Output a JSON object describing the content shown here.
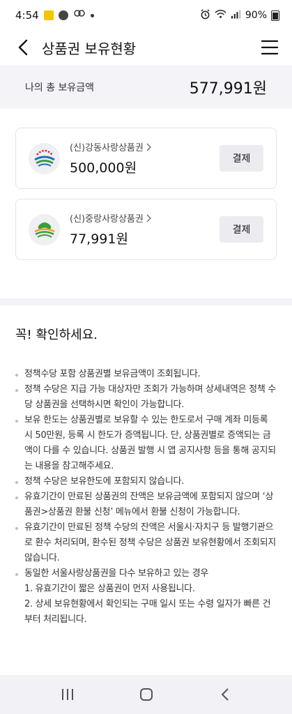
{
  "status_bar": {
    "time": "4:54",
    "battery": "90%"
  },
  "header": {
    "title": "상품권 보유현황"
  },
  "summary": {
    "label": "나의 총 보유금액",
    "amount": "577,991원"
  },
  "vouchers": [
    {
      "name": "(신)강동사랑상품권",
      "amount": "500,000원",
      "pay_label": "결제"
    },
    {
      "name": "(신)중랑사랑상품권",
      "amount": "77,991원",
      "pay_label": "결제"
    }
  ],
  "notice": {
    "title": "꼭! 확인하세요.",
    "items": [
      "정책수당 포함 상품권별 보유금액이 조회됩니다.",
      "정책 수당은 지급 가능 대상자만 조회가 가능하며 상세내역은 정책 수당 상품권을 선택하시면 확인이 가능합니다.",
      "보유 한도는 상품권별로 보유할 수 있는 한도로서 구매 계좌 미등록 시 50만원, 등록 시 한도가 증액됩니다. 단, 상품권별로 증액되는 금액이 다를 수 있습니다. 상품권 발행 시 앱 공지사항 등을 통해 공지되는 내용을 참고해주세요.",
      "정책 수당은 보유한도에 포함되지 않습니다.",
      "유효기간이 만료된 상품권의 잔액은 보유금액에 포함되지 않으며 ‘상품권>상품권 환불 신청’ 메뉴에서 환불 신청이 가능합니다.",
      "유효기간이 만료된 정책 수당의 잔액은 서울시·자치구 등 발행기관으로 환수 처리되며, 환수된 정책 수당은 상품권 보유현황에서 조회되지 않습니다."
    ],
    "last_item": {
      "text": "동일한 서울사랑상품권을 다수 보유하고 있는 경우",
      "sub1": "1. 유효기간이 짧은 상품권이 먼저 사용됩니다.",
      "sub2": "2. 상세 보유현황에서 확인되는 구매 일시 또는 수령 일자가 빠른 건부터 처리됩니다."
    }
  },
  "colors": {
    "summary_bg": "#f3f3f8",
    "button_bg": "#ecebf0",
    "logo_red": "#d9262b",
    "logo_green": "#3a9b43",
    "logo_blue": "#1c6fb8"
  }
}
